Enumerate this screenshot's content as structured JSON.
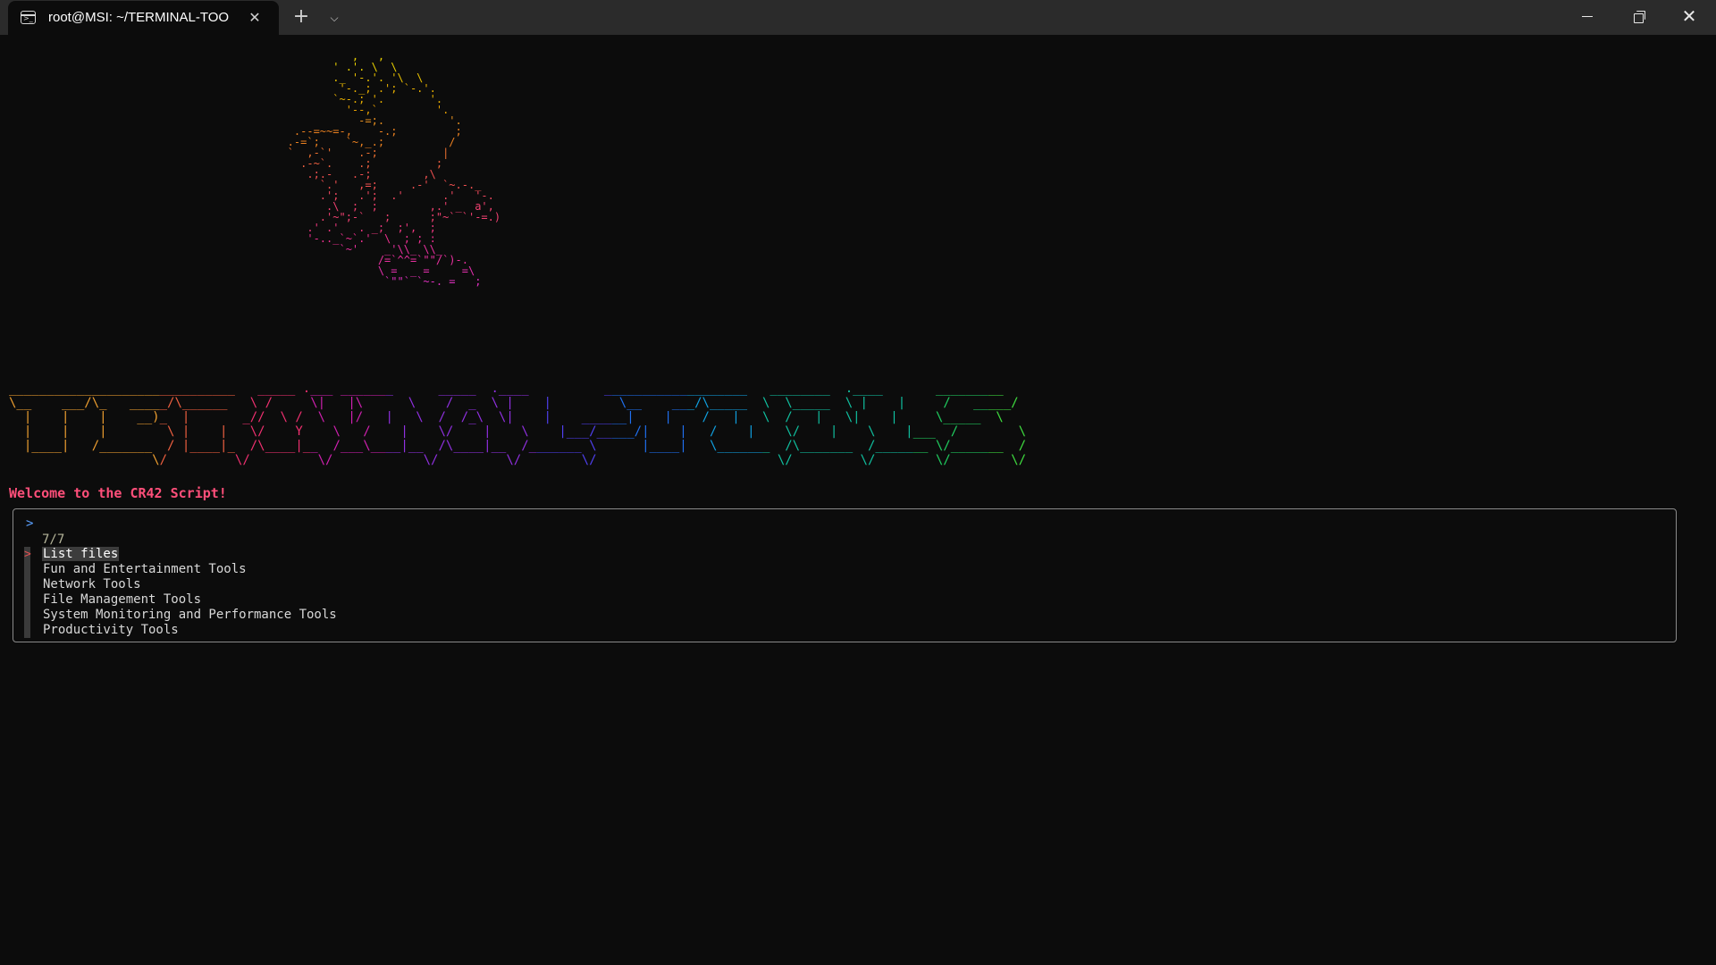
{
  "window": {
    "tab_title": "root@MSI: ~/TERMINAL-TOO",
    "tab_close": "✕",
    "new_tab": "+",
    "dropdown": "⌄",
    "minimize": "",
    "close": "✕"
  },
  "colors": {
    "background": "#0c0c0c",
    "titlebar": "#2b2b2b",
    "welcome": "#ff4f7a",
    "prompt": "#5aa0ff",
    "box_border": "#8a8a8a",
    "cursor": "#e05050"
  },
  "terminal": {
    "welcome": "Welcome to the CR42 Script!",
    "prompt": ">",
    "count": "7/7",
    "menu": [
      {
        "label": "List files",
        "selected": true
      },
      {
        "label": "Fun and Entertainment Tools"
      },
      {
        "label": "Network Tools"
      },
      {
        "label": "File Management Tools"
      },
      {
        "label": "System Monitoring and Performance Tools"
      },
      {
        "label": "Productivity Tools"
      }
    ],
    "cursor_glyph": ">",
    "dragon_art": "             ,   ,\n          ' .'. \\  \\\n          ._ '-.'. '\\  \\\n           '-._; .'; `-.'.\n          `~-.; '.       '.\n            '--,`         '.\n              -=;.          '.\n    .--=~~=-,    -.;         ;\n   .-=`;    `~,_.;          /\n   `  ,-`'    .-;          |\n     .-~`.    .;          ;\n      .;.-   .-;        ,\\\n        `.'   ,=;     .-'  `~.-._\n        .';   .';  .'      .'   '-.\n         .\\  ;  ;        ,.' _  a',\n        .'~\";-`   ;      ;\"~` `'-=.)\n      .' .'   . _;  ;',  ;\n      '-.._`~`.'  \\  ; ; :\n           `~'    _'\\\\_ \\\\_\n                 /=`^^=`\"\"/`)-.\n                 \\ =  _ =     =\\\n                  `\"\"` `~-. =   ;",
    "banner_art": "______________________________   _____ .___ _______      _____  .____          ___________________   ________  .____       _________\n\\__    ___/\\_   _____/\\______   \\ /     \\|   |\\      \\    /  _  \\ |    |         \\__    ___/\\_____  \\  \\_____  \\ |    |     /   _____/\n  |    |    |    __)_  |       _//  \\ /  \\   |/   |   \\  /  /_\\  \\|    |    ______|    |    /   |   \\  /   |   \\|    |     \\_____  \\\n  |    |    |        \\ |    |   \\/    Y    \\   /    |    \\/    |    \\    |___/_____/|    |   /    |    \\/    |    \\    |___  /        \\\n  |____|   /_______  / |____|_  /\\____|__  /___\\____|__  /\\____|__  /_______ \\      |____|   \\_______  /\\_______  /_______ \\/_______  /\n                   \\/         \\/         \\/            \\/         \\/        \\/                        \\/         \\/        \\/        \\/"
  }
}
